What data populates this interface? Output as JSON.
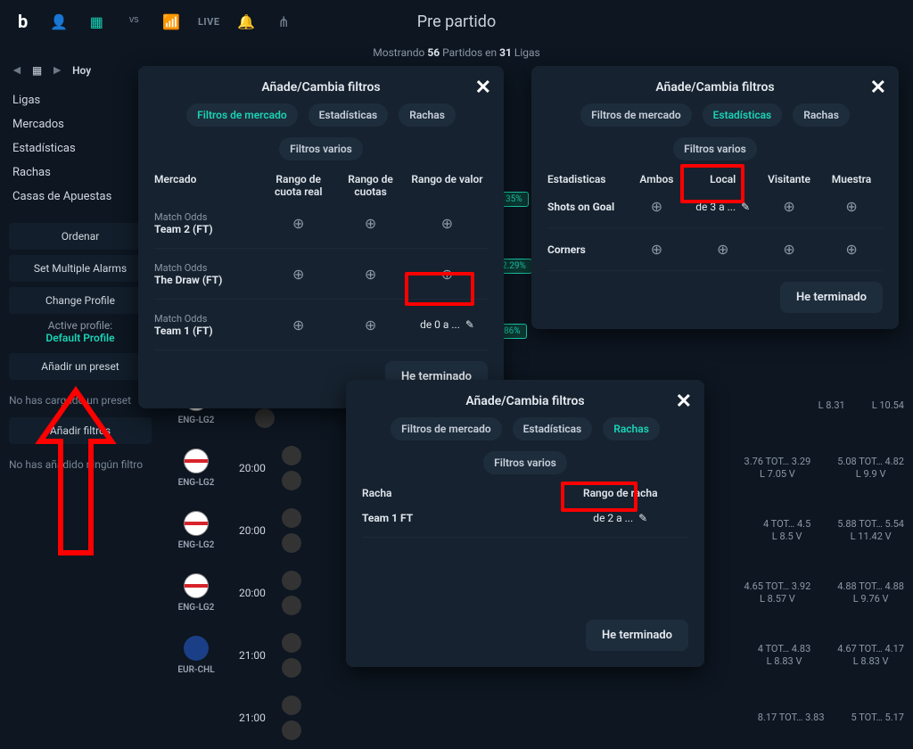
{
  "header": {
    "page_title": "Pre partido",
    "live_label": "LIVE",
    "showing_prefix": "Mostrando",
    "match_count": "56",
    "matches_word": "Partidos en",
    "league_count": "31",
    "leagues_word": "Ligas"
  },
  "sidebar": {
    "today": "Hoy",
    "items": [
      "Ligas",
      "Mercados",
      "Estadísticas",
      "Rachas",
      "Casas de Apuestas"
    ],
    "order_btn": "Ordenar",
    "set_alarms": "Set Multiple Alarms",
    "change_profile": "Change Profile",
    "active_profile_label": "Active profile:",
    "active_profile_value": "Default Profile",
    "add_preset": "Añadir un preset",
    "no_preset_note": "No has cargado un preset",
    "add_filters_btn": "Añadir filtros",
    "no_filters_note": "No has añadido ningún filtro"
  },
  "modal1": {
    "title": "Añade/Cambia filtros",
    "tabs": [
      "Filtros de mercado",
      "Estadísticas",
      "Rachas",
      "Filtros varios"
    ],
    "active_tab": 0,
    "headers": [
      "Mercado",
      "Rango de cuota real",
      "Rango de cuotas",
      "Rango de valor"
    ],
    "rows": [
      {
        "top": "Match Odds",
        "bot": "Team 2 (FT)",
        "r1": "⊕",
        "r2": "⊕",
        "r3": "⊕"
      },
      {
        "top": "Match Odds",
        "bot": "The Draw (FT)",
        "r1": "⊕",
        "r2": "⊕",
        "r3": "⊕"
      },
      {
        "top": "Match Odds",
        "bot": "Team 1 (FT)",
        "r1": "⊕",
        "r2": "⊕",
        "r3": "de 0 a ..."
      }
    ],
    "done": "He terminado"
  },
  "modal2": {
    "title": "Añade/Cambia filtros",
    "tabs": [
      "Filtros de mercado",
      "Estadísticas",
      "Rachas",
      "Filtros varios"
    ],
    "active_tab": 1,
    "headers": [
      "Estadisticas",
      "Ambos",
      "Local",
      "Visitante",
      "Muestra"
    ],
    "rows": [
      {
        "name": "Shots on Goal",
        "a": "⊕",
        "l": "de 3 a ...",
        "v": "⊕",
        "m": "⊕"
      },
      {
        "name": "Corners",
        "a": "⊕",
        "l": "⊕",
        "v": "⊕",
        "m": "⊕"
      }
    ],
    "done": "He terminado"
  },
  "modal3": {
    "title": "Añade/Cambia filtros",
    "tabs": [
      "Filtros de mercado",
      "Estadísticas",
      "Rachas",
      "Filtros varios"
    ],
    "active_tab": 2,
    "headers": [
      "Racha",
      "Rango de racha"
    ],
    "rows": [
      {
        "name": "Team 1 FT",
        "val": "de 2 a ..."
      }
    ],
    "done": "He terminado"
  },
  "bg_percents": [
    "35%",
    "2.29%",
    "86%"
  ],
  "bg_rows": [
    {
      "lg": "ENG-LG2",
      "time": "",
      "n1t": "",
      "n1b": "",
      "n2t": "L  8.31",
      "n2b": "",
      "n3t": "L  10.54",
      "n3b": "",
      "flag": "eng"
    },
    {
      "lg": "ENG-LG2",
      "time": "20:00",
      "n1t": "3.76  TOT…  3.29",
      "n1b": "L   7.05    V",
      "n2t": "5.08  TOT…  4.82",
      "n2b": "L    9.9    V",
      "flag": "eng"
    },
    {
      "lg": "ENG-LG2",
      "time": "20:00",
      "n1t": "4   TOT…   4.5",
      "n1b": "L    8.5     V",
      "n2t": "5.88  TOT…  5.54",
      "n2b": "L   11.42   V",
      "flag": "eng"
    },
    {
      "lg": "ENG-LG2",
      "time": "20:00",
      "n1t": "4.65  TOT…  3.92",
      "n1b": "L   8.57    V",
      "n2t": "4.88  TOT…  4.88",
      "n2b": "L   9.76    V",
      "flag": "eng"
    },
    {
      "lg": "EUR-CHL",
      "time": "21:00",
      "n1t": "4   TOT…   4.83",
      "n1b": "L   8.83    V",
      "n2t": "4.67  TOT…  4.17",
      "n2b": "L   8.83    V",
      "flag": "eur"
    },
    {
      "lg": "",
      "time": "21:00",
      "n1t": "8.17  TOT…  3.83",
      "n1b": "",
      "n2t": "5   TOT…   5.17",
      "n2b": "",
      "flag": "eur"
    }
  ]
}
